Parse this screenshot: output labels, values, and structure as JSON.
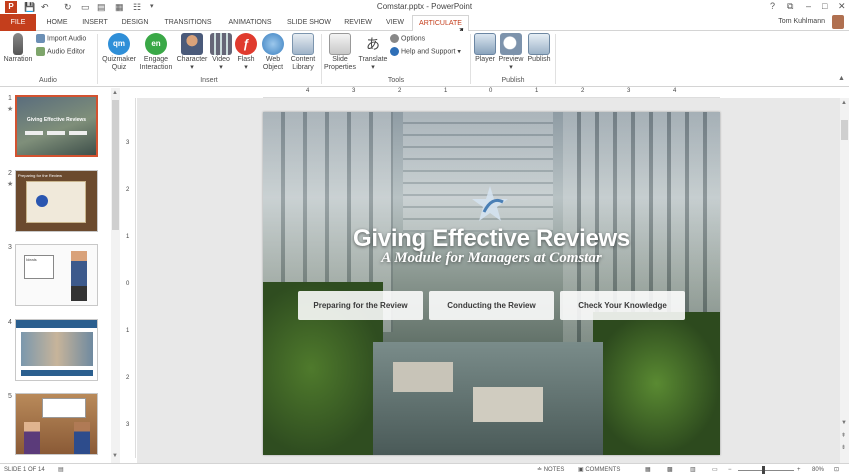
{
  "app": {
    "doc_title": "Comstar.pptx - PowerPoint",
    "help": "?"
  },
  "quick_access": {
    "save_icon": "save-icon",
    "undo_icon": "undo-icon",
    "redo_icon": "redo-icon"
  },
  "tabs": [
    "FILE",
    "HOME",
    "INSERT",
    "DESIGN",
    "TRANSITIONS",
    "ANIMATIONS",
    "SLIDE SHOW",
    "REVIEW",
    "VIEW",
    "ARTICULATE"
  ],
  "user": "Tom Kuhlmann",
  "ribbon": {
    "narration": "Narration",
    "import_audio": "Import Audio",
    "audio_editor": "Audio Editor",
    "audio_group": "Audio",
    "quizmaker_l1": "Quizmaker",
    "quizmaker_l2": "Quiz",
    "quizmaker_badge": "qm",
    "engage_l1": "Engage",
    "engage_l2": "Interaction",
    "engage_badge": "en",
    "character": "Character",
    "video": "Video",
    "flash": "Flash",
    "web_l1": "Web",
    "web_l2": "Object",
    "content_l1": "Content",
    "content_l2": "Library",
    "insert_group": "Insert",
    "slide_props_l1": "Slide",
    "slide_props_l2": "Properties",
    "translate": "Translate",
    "options": "Options",
    "help_support": "Help and Support",
    "tools_group": "Tools",
    "player": "Player",
    "preview": "Preview",
    "publish": "Publish",
    "publish_group": "Publish"
  },
  "thumbnails": [
    {
      "num": "1",
      "star": "★",
      "mini_title": "Giving Effective Reviews"
    },
    {
      "num": "2",
      "star": "★",
      "mini_title": "Preparing for the Review"
    },
    {
      "num": "3",
      "star": "",
      "mini_title": "Ideals"
    },
    {
      "num": "4",
      "star": "",
      "mini_title": ""
    },
    {
      "num": "5",
      "star": "",
      "mini_title": ""
    }
  ],
  "ruler": {
    "h_labels": [
      "4",
      "3",
      "2",
      "1",
      "0",
      "1",
      "2",
      "3",
      "4"
    ],
    "v_labels": [
      "3",
      "2",
      "1",
      "0",
      "1",
      "2",
      "3"
    ]
  },
  "slide": {
    "title": "Giving Effective Reviews",
    "subtitle": "A Module for Managers at Comstar",
    "buttons": [
      "Preparing for the Review",
      "Conducting the Review",
      "Check Your Knowledge"
    ]
  },
  "status": {
    "slide_info": "SLIDE 1 OF 14",
    "notes": "NOTES",
    "comments": "COMMENTS",
    "zoom": "80%"
  },
  "colors": {
    "accent": "#c43e1c",
    "qm": "#2f8fd8",
    "en": "#3aa847",
    "flash": "#e03a2e"
  }
}
